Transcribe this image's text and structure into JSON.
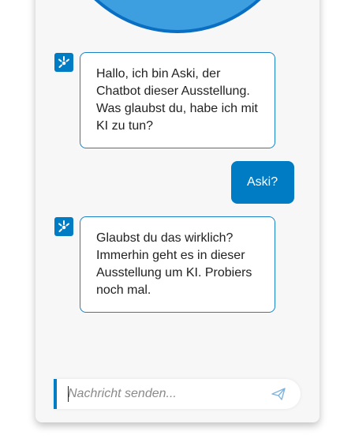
{
  "conversation": [
    {
      "from": "bot",
      "text": "Hallo, ich bin Aski, der Chatbot dieser Ausstellung. Was glaubst du, habe ich mit KI zu tun?"
    },
    {
      "from": "user",
      "text": "Aski?"
    },
    {
      "from": "bot",
      "text": "Glaubst du das wirklich? Immerhin geht es in dieser Ausstellung um KI. Probiers noch mal."
    }
  ],
  "composer": {
    "placeholder": "Nachricht senden...",
    "value": ""
  },
  "icons": {
    "bot_avatar": "aski-bot-icon",
    "send": "paper-plane-icon",
    "header": "search-magnifier-icon"
  },
  "colors": {
    "accent": "#007cc4",
    "header_fill": "#3d9fe0",
    "bubble_border": "#1a82c9",
    "panel_bg": "#f7f7f7"
  }
}
